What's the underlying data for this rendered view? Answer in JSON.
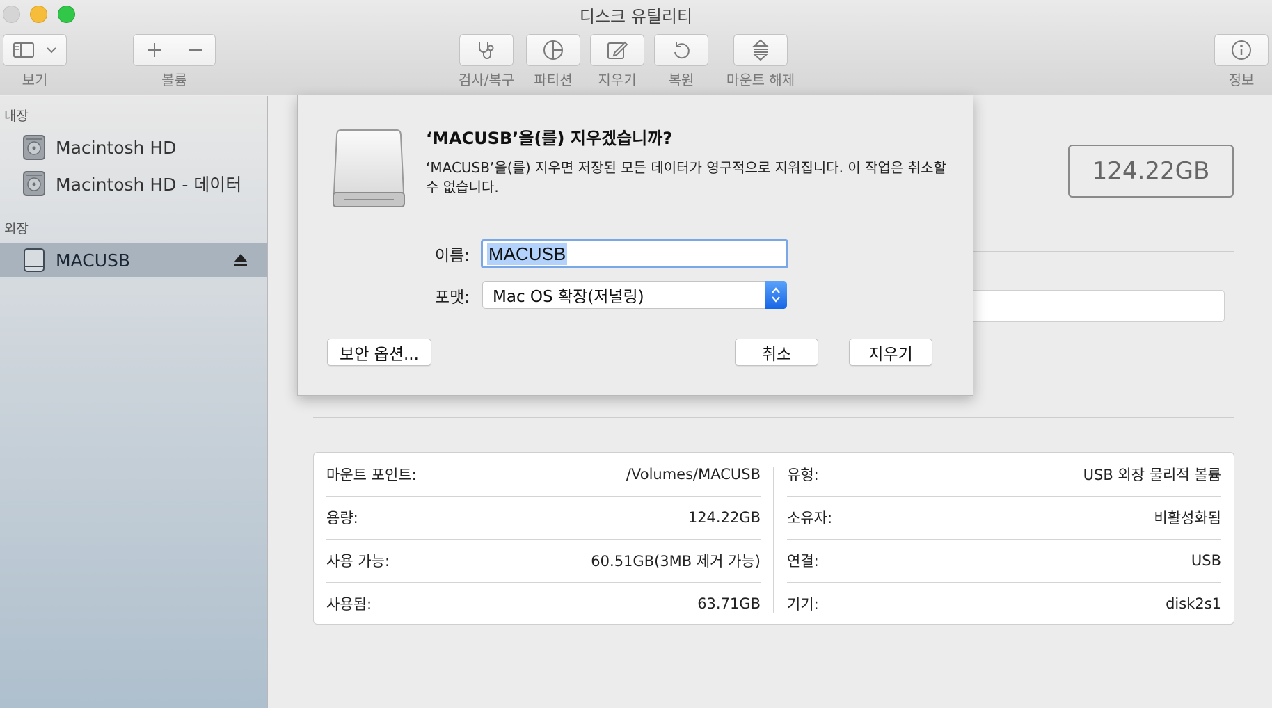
{
  "window": {
    "title": "디스크 유틸리티"
  },
  "toolbar": {
    "view_label": "보기",
    "volume_label": "볼륨",
    "firstaid_label": "검사/복구",
    "partition_label": "파티션",
    "erase_label": "지우기",
    "restore_label": "복원",
    "unmount_label": "마운트 해제",
    "info_label": "정보"
  },
  "sidebar": {
    "internal_header": "내장",
    "external_header": "외장",
    "internal_items": [
      {
        "label": "Macintosh HD"
      },
      {
        "label": "Macintosh HD - 데이터"
      }
    ],
    "external_items": [
      {
        "label": "MACUSB",
        "selected": true
      }
    ]
  },
  "main": {
    "capacity": "124.22GB"
  },
  "info": {
    "left": [
      {
        "key": "마운트 포인트:",
        "value": "/Volumes/MACUSB"
      },
      {
        "key": "용량:",
        "value": "124.22GB"
      },
      {
        "key": "사용 가능:",
        "value": "60.51GB(3MB 제거 가능)"
      },
      {
        "key": "사용됨:",
        "value": "63.71GB"
      }
    ],
    "right": [
      {
        "key": "유형:",
        "value": "USB 외장 물리적 볼륨"
      },
      {
        "key": "소유자:",
        "value": "비활성화됨"
      },
      {
        "key": "연결:",
        "value": "USB"
      },
      {
        "key": "기기:",
        "value": "disk2s1"
      }
    ]
  },
  "dialog": {
    "title": "‘MACUSB’을(를) 지우겠습니까?",
    "message": "‘MACUSB’을(를) 지우면 저장된 모든 데이터가 영구적으로 지워집니다. 이 작업은 취소할 수 없습니다.",
    "name_label": "이름:",
    "name_value": "MACUSB",
    "format_label": "포맷:",
    "format_value": "Mac OS 확장(저널링)",
    "security_button": "보안 옵션...",
    "cancel_button": "취소",
    "erase_button": "지우기"
  },
  "colors": {
    "accent": "#1766e6",
    "sidebar_selected": "#a9b3be",
    "focus_ring": "#7aa7e6"
  }
}
